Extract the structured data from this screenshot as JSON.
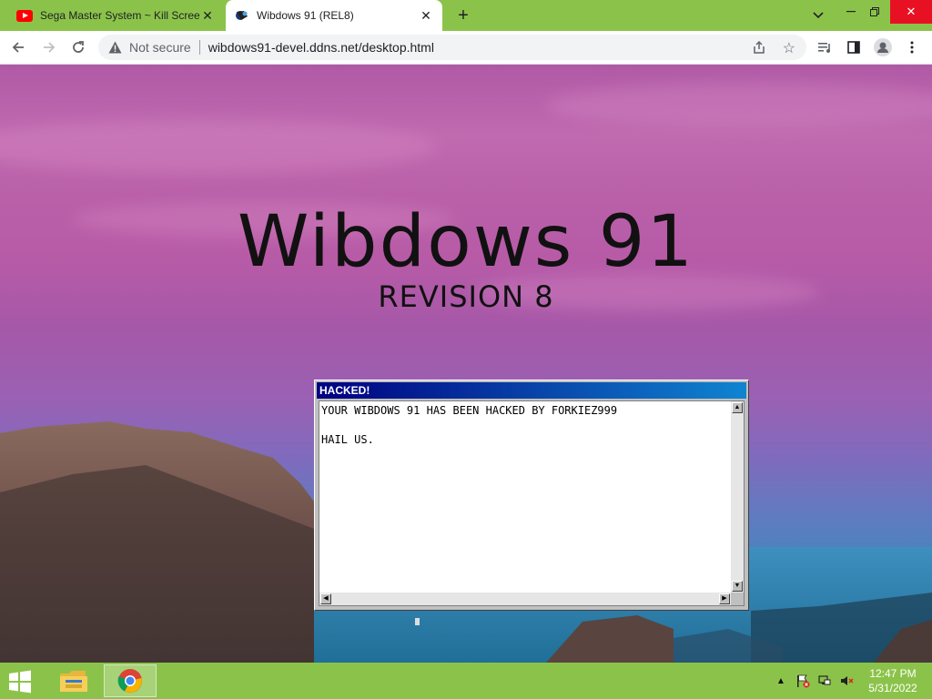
{
  "browser": {
    "tabs": [
      {
        "label": "Sega Master System ~ Kill Screen",
        "icon": "youtube-icon"
      },
      {
        "label": "Wibdows 91 (REL8)",
        "icon": "wibdows-icon"
      }
    ],
    "new_tab_glyph": "+",
    "window_controls": {
      "minimize": "—",
      "restore": "❐",
      "close": "✕"
    },
    "address": {
      "security_label": "Not secure",
      "url": "wibdows91-devel.ddns.net/desktop.html"
    },
    "colors": {
      "frame": "#8bc34a",
      "close": "#e81123"
    }
  },
  "desktop": {
    "title": "Wibdows 91",
    "subtitle": "REVISION 8"
  },
  "hacked_window": {
    "title": "HACKED!",
    "lines": [
      "YOUR WIBDOWS 91 HAS BEEN HACKED BY FORKIEZ999",
      "",
      "HAIL US."
    ]
  },
  "taskbar": {
    "pinned": [
      {
        "name": "file-explorer-icon"
      },
      {
        "name": "chrome-icon"
      }
    ],
    "clock": {
      "time": "12:47 PM",
      "date": "5/31/2022"
    }
  }
}
